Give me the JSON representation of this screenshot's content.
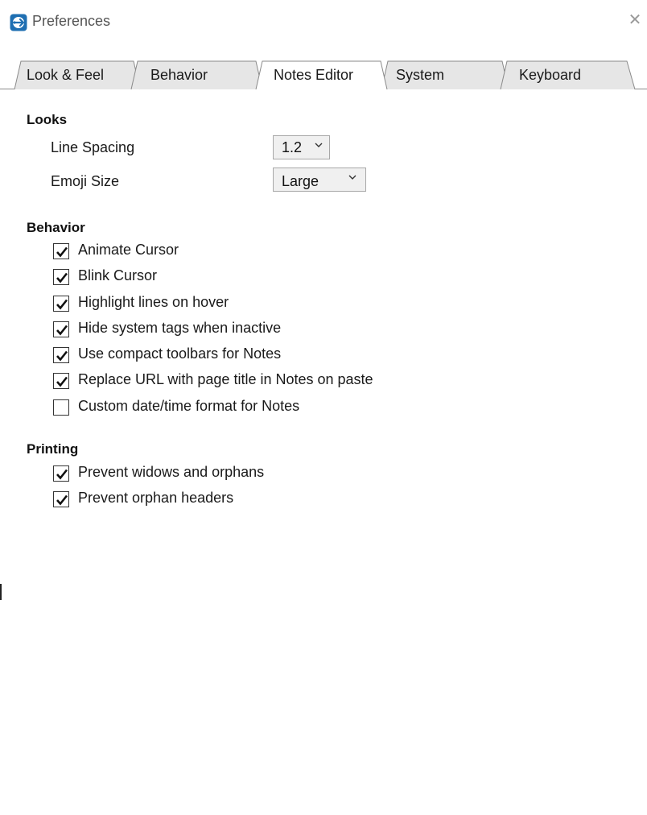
{
  "window": {
    "title": "Preferences",
    "app_icon": "app-logo-icon",
    "close_icon": "close-icon"
  },
  "tabs": [
    {
      "label": "Look & Feel",
      "active": false
    },
    {
      "label": "Behavior",
      "active": false
    },
    {
      "label": "Notes Editor",
      "active": true
    },
    {
      "label": "System",
      "active": false
    },
    {
      "label": "Keyboard",
      "active": false
    }
  ],
  "looks": {
    "title": "Looks",
    "line_spacing": {
      "label": "Line Spacing",
      "value": "1.2"
    },
    "emoji_size": {
      "label": "Emoji Size",
      "value": "Large"
    }
  },
  "behavior": {
    "title": "Behavior",
    "options": [
      {
        "label": "Animate Cursor",
        "checked": true
      },
      {
        "label": "Blink Cursor",
        "checked": true
      },
      {
        "label": "Highlight lines on hover",
        "checked": true
      },
      {
        "label": "Hide system tags when inactive",
        "checked": true
      },
      {
        "label": "Use compact toolbars for Notes",
        "checked": true
      },
      {
        "label": "Replace URL with page title in Notes on paste",
        "checked": true
      },
      {
        "label": "Custom date/time format for Notes",
        "checked": false
      }
    ]
  },
  "printing": {
    "title": "Printing",
    "options": [
      {
        "label": "Prevent widows and orphans",
        "checked": true
      },
      {
        "label": "Prevent orphan headers",
        "checked": true
      }
    ]
  },
  "colors": {
    "tab_inactive": "#e6e6e6",
    "tab_active": "#ffffff",
    "tab_border": "#8a8a8a",
    "icon_blue": "#1f6fb2"
  }
}
